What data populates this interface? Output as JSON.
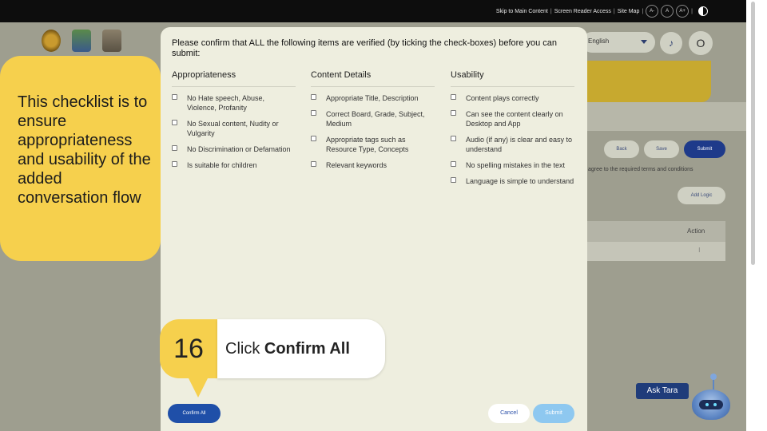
{
  "topbar": {
    "skip_link": "Skip to Main Content",
    "screen_reader": "Screen Reader Access",
    "site_map": "Site Map",
    "font_decrease": "A-",
    "font_normal": "A",
    "font_increase": "A+",
    "separator": "|"
  },
  "background": {
    "language_value": "English",
    "avatar_initial": "O",
    "back_label": "Back",
    "save_label": "Save",
    "submit_label": "Submit",
    "terms_text": "agree to the required terms and conditions",
    "add_logic_label": "Add Logic",
    "table_header_action": "Action",
    "table_row_action": "⁝",
    "ask_tara_label": "Ask Tara"
  },
  "modal": {
    "title": "Please confirm that ALL the following items are verified (by ticking the check-boxes) before you can submit:",
    "columns": [
      {
        "heading": "Appropriateness",
        "items": [
          "No Hate speech, Abuse, Violence, Profanity",
          "No Sexual content, Nudity or Vulgarity",
          "No Discrimination or Defamation",
          "Is suitable for children"
        ]
      },
      {
        "heading": "Content Details",
        "items": [
          "Appropriate Title, Description",
          "Correct Board, Grade, Subject, Medium",
          "Appropriate tags such as Resource Type, Concepts",
          "Relevant keywords"
        ]
      },
      {
        "heading": "Usability",
        "items": [
          "Content plays correctly",
          "Can see the content clearly on Desktop and App",
          "Audio (if any) is clear and easy to understand",
          "No spelling mistakes in the text",
          "Language is simple to understand"
        ]
      }
    ],
    "confirm_all_label": "Confirm All",
    "cancel_label": "Cancel",
    "submit_label": "Submit"
  },
  "tutorial": {
    "callout_text": "This checklist is to ensure appropriateness and usability of the added conversation flow",
    "step_number": "16",
    "step_prefix": "Click ",
    "step_action": "Confirm All"
  },
  "colors": {
    "primary": "#1f4fa8",
    "callout": "#f6d04d",
    "modal_bg": "#eeeedf"
  }
}
